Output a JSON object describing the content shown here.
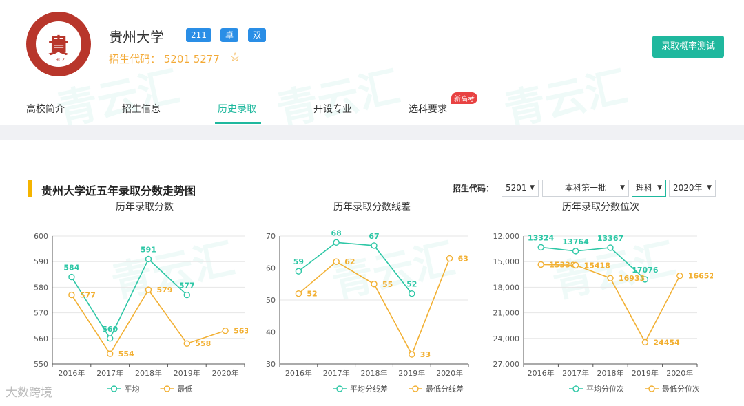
{
  "header": {
    "logo_char": "貴",
    "logo_year": "1902",
    "name": "贵州大学",
    "badges": [
      "211",
      "卓",
      "双"
    ],
    "code_text": "招生代码：  5201   5277",
    "test_button": "录取概率测试"
  },
  "nav": {
    "items": [
      "高校简介",
      "招生信息",
      "历史录取",
      "开设专业",
      "选科要求"
    ],
    "active": "历史录取",
    "new_tag": "新高考"
  },
  "section": {
    "title": "贵州大学近五年录取分数走势图",
    "filter_label": "招生代码：",
    "filters": [
      "5201",
      "本科第一批",
      "理科",
      "2020年"
    ]
  },
  "footer_watermark": "大数跨境",
  "watermark_text": "青云汇",
  "colors": {
    "teal": "#2ec7a6",
    "orange": "#f2b033"
  },
  "chart_data": [
    {
      "type": "line",
      "title": "历年录取分数",
      "categories": [
        "2016年",
        "2017年",
        "2018年",
        "2019年",
        "2020年"
      ],
      "ylim": [
        550,
        600
      ],
      "yticks": [
        "600",
        "590",
        "580",
        "570",
        "560",
        "550"
      ],
      "inverted": false,
      "series": [
        {
          "name": "平均",
          "color": "#2ec7a6",
          "values": [
            584,
            560,
            591,
            577,
            null
          ],
          "labels": [
            "584",
            "560",
            "591",
            "577",
            ""
          ]
        },
        {
          "name": "最低",
          "color": "#f2b033",
          "values": [
            577,
            554,
            579,
            558,
            563
          ],
          "labels": [
            "577",
            "554",
            "579",
            "558",
            "563"
          ]
        }
      ]
    },
    {
      "type": "line",
      "title": "历年录取分数线差",
      "categories": [
        "2016年",
        "2017年",
        "2018年",
        "2019年",
        "2020年"
      ],
      "ylim": [
        30,
        70
      ],
      "yticks": [
        "70",
        "60",
        "50",
        "40",
        "30"
      ],
      "inverted": false,
      "series": [
        {
          "name": "平均分线差",
          "color": "#2ec7a6",
          "values": [
            59,
            68,
            67,
            52,
            null
          ],
          "labels": [
            "59",
            "68",
            "67",
            "52",
            ""
          ]
        },
        {
          "name": "最低分线差",
          "color": "#f2b033",
          "values": [
            52,
            62,
            55,
            33,
            63
          ],
          "labels": [
            "52",
            "62",
            "55",
            "33",
            "63"
          ]
        }
      ]
    },
    {
      "type": "line",
      "title": "历年录取分数位次",
      "categories": [
        "2016年",
        "2017年",
        "2018年",
        "2019年",
        "2020年"
      ],
      "ylim": [
        12000,
        27000
      ],
      "yticks": [
        "12,000",
        "15,000",
        "18,000",
        "21,000",
        "24,000",
        "27,000"
      ],
      "inverted": true,
      "series": [
        {
          "name": "平均分位次",
          "color": "#2ec7a6",
          "values": [
            13324,
            13764,
            13367,
            17076,
            null
          ],
          "labels": [
            "13324",
            "13764",
            "13367",
            "17076",
            ""
          ]
        },
        {
          "name": "最低分位次",
          "color": "#f2b033",
          "values": [
            15338,
            15418,
            16933,
            24454,
            16652
          ],
          "labels": [
            "15338",
            "15418",
            "16933",
            "24454",
            "16652"
          ]
        }
      ]
    }
  ]
}
